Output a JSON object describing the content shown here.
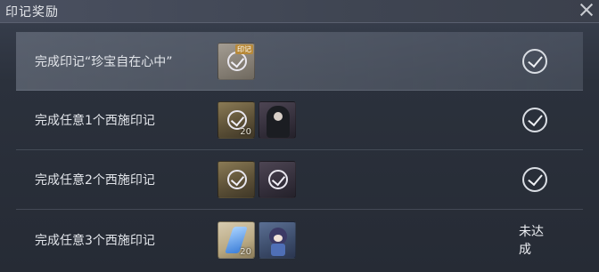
{
  "window": {
    "title": "印记奖励"
  },
  "rows": [
    {
      "label": "完成印记“珍宝自在心中”",
      "items": [
        {
          "icon": "mark-check-icon",
          "tag": "印记",
          "qty": ""
        }
      ],
      "status": "done"
    },
    {
      "label": "完成任意1个西施印记",
      "items": [
        {
          "icon": "mark-check-icon",
          "qty": "20"
        },
        {
          "icon": "character-portrait-icon",
          "qty": ""
        }
      ],
      "status": "done"
    },
    {
      "label": "完成任意2个西施印记",
      "items": [
        {
          "icon": "mark-check-icon",
          "qty": ""
        },
        {
          "icon": "mark-check-icon",
          "qty": ""
        }
      ],
      "status": "done"
    },
    {
      "label": "完成任意3个西施印记",
      "items": [
        {
          "icon": "crystal-icon",
          "qty": "20"
        },
        {
          "icon": "chibi-character-icon",
          "qty": ""
        }
      ],
      "status_text": "未达成"
    }
  ]
}
